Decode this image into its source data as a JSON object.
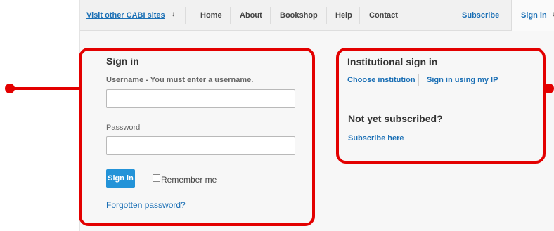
{
  "nav": {
    "cabi_sites": "Visit other CABI sites",
    "select_arrows": "↕",
    "home": "Home",
    "about": "About",
    "bookshop": "Bookshop",
    "help": "Help",
    "contact": "Contact",
    "subscribe": "Subscribe",
    "sign_in": "Sign in"
  },
  "signin": {
    "title": "Sign in",
    "username_label": "Username  - You must enter a username.",
    "username_value": "",
    "password_label": "Password",
    "password_value": "",
    "button": "Sign in",
    "remember_me": "Remember me",
    "remember_checked": false,
    "forgot": "Forgotten password?"
  },
  "institutional": {
    "title": "Institutional sign in",
    "choose": "Choose institution",
    "ip": "Sign in using my IP",
    "not_subscribed": "Not yet subscribed?",
    "subscribe_here": "Subscribe here"
  },
  "annotation": {
    "color": "#e30000"
  },
  "colors": {
    "accent": "#2393d8",
    "link": "#1a6fb5"
  }
}
